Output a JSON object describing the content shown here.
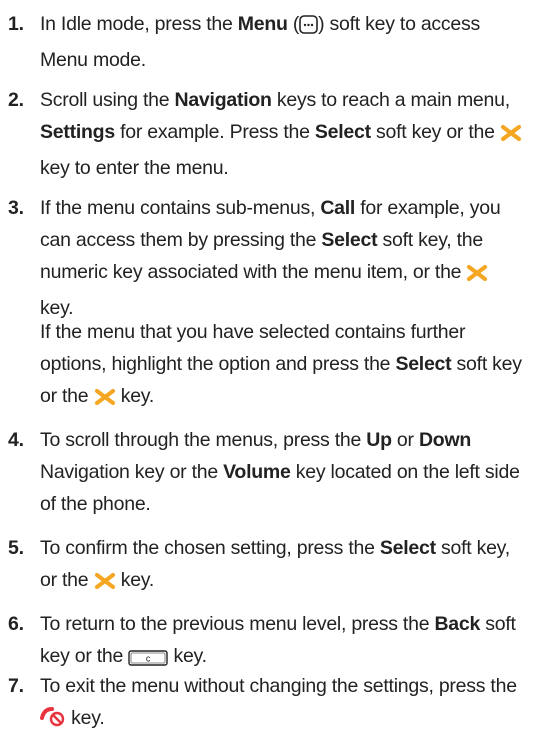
{
  "steps": [
    {
      "num": "1.",
      "parts": [
        "In Idle mode, press the ",
        "Menu",
        " (",
        ") soft key to access Menu mode."
      ]
    },
    {
      "num": "2.",
      "parts": [
        "Scroll using the ",
        "Navigation",
        " keys to reach a main menu, ",
        "Settings",
        " for example. Press the ",
        "Select",
        " soft key or the ",
        " key to enter the menu."
      ]
    },
    {
      "num": "3.",
      "parts": [
        "If the menu contains sub-menus, ",
        "Call",
        " for example, you can access them by pressing the ",
        "Select",
        " soft key, the numeric key associated with the menu item, or the ",
        " key."
      ],
      "extra": [
        "If the menu that you have selected contains further options, highlight the option and press the ",
        "Select",
        " soft key or the ",
        " key."
      ]
    },
    {
      "num": "4.",
      "parts": [
        "To scroll through the menus, press the ",
        "Up",
        " or ",
        "Down",
        " Navigation key or the ",
        "Volume",
        " key located on the left side of the phone."
      ]
    },
    {
      "num": "5.",
      "parts": [
        "To confirm the chosen setting, press the ",
        "Select",
        " soft key, or the ",
        " key."
      ]
    },
    {
      "num": "6.",
      "parts": [
        "To return to the previous menu level, press the ",
        "Back",
        " soft key or the ",
        " key."
      ]
    },
    {
      "num": "7.",
      "parts": [
        "To exit the menu without changing the settings, press the ",
        " key."
      ]
    }
  ],
  "icons": {
    "menu_key": "menu-softkey-icon",
    "select_key": "orange-x-select-key-icon",
    "clear_key": "c-clear-key-icon",
    "end_key": "red-end-call-key-icon"
  },
  "colors": {
    "text": "#222222",
    "select_key": "#f5a623",
    "end_key": "#e8333f"
  }
}
